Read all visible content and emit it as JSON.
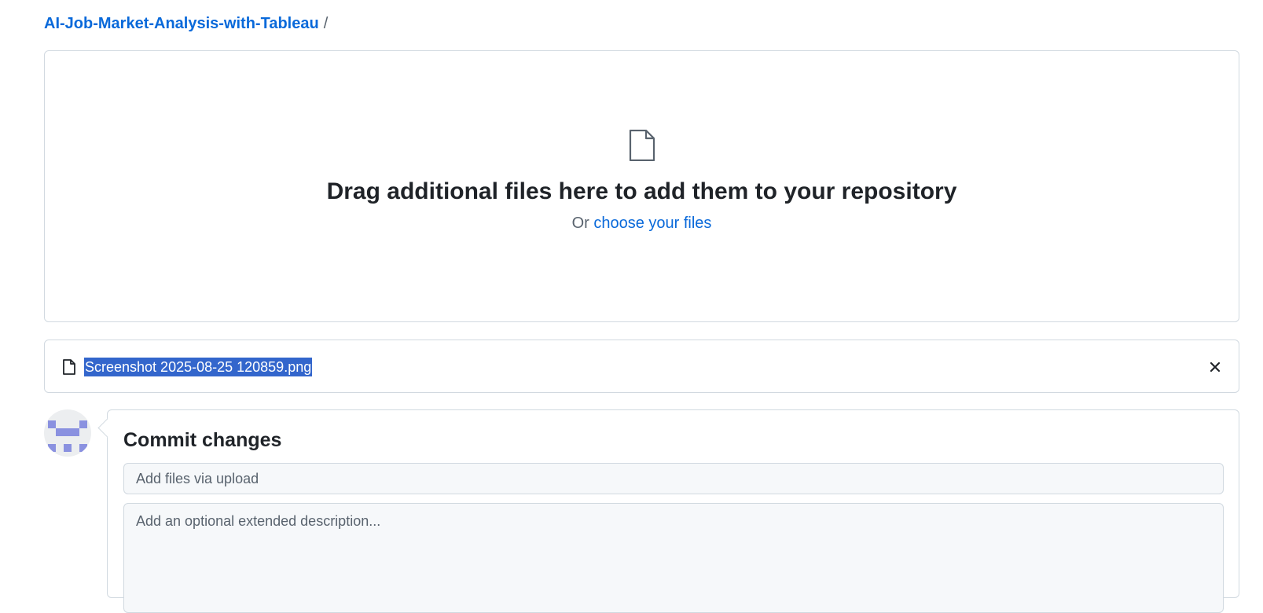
{
  "breadcrumb": {
    "repo_name": "AI-Job-Market-Analysis-with-Tableau",
    "separator": "/"
  },
  "dropzone": {
    "icon": "file-icon",
    "heading": "Drag additional files here to add them to your repository",
    "prefix": "Or",
    "choose_link": "choose your files"
  },
  "uploaded_files": [
    {
      "icon": "file-icon",
      "name": "Screenshot 2025-08-25 120859.png",
      "remove_icon": "close-icon"
    }
  ],
  "commit": {
    "heading": "Commit changes",
    "summary_placeholder": "Add files via upload",
    "description_placeholder": "Add an optional extended description..."
  },
  "colors": {
    "link": "#0969da",
    "selection_highlight": "#3366cc",
    "border": "#d1d9e0",
    "avatar_identicon": "#8a91e0"
  }
}
